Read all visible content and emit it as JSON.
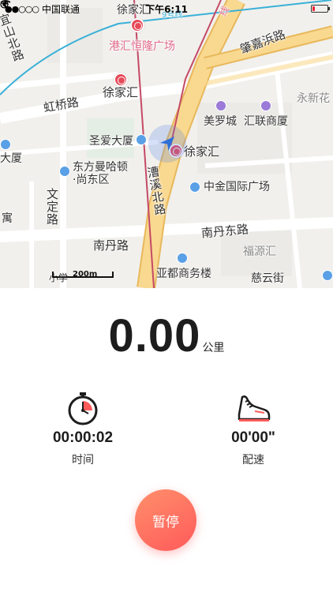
{
  "status_bar": {
    "signal": "●●○○○",
    "carrier": "中国联通",
    "wifi_icon": "wifi-icon",
    "time": "下午6:11",
    "battery_level": 0.15
  },
  "map": {
    "labels": {
      "xujiahui_top": "徐家汇",
      "ganghui": "港汇恒隆广场",
      "zhaojiabang": "肇嘉浜路",
      "yishan": "宜山北路",
      "xujiahui_left": "徐家汇",
      "hongqiao": "虹桥路",
      "yongxinhua": "永新花",
      "meiluocheng": "美罗城",
      "huilian": "汇联商厦",
      "shengai": "圣爱大厦",
      "xujiahui_station": "徐家汇",
      "daxia": "大厦",
      "dongfang": "东方曼哈顿",
      "shangdong": "·尚东区",
      "caoxi": "漕溪北路",
      "zhongjin": "中金国际广场",
      "wending": "文定路",
      "yu": "寓",
      "nandan": "南丹路",
      "nandan_east": "南丹东路",
      "fuyuan": "福源汇",
      "yadu": "亚都商务楼",
      "ciyun": "慈云街",
      "xiaoxue": "小学",
      "line_label": "线",
      "line_label2": "9号线"
    },
    "scale": "200m"
  },
  "distance": {
    "value": "0.00",
    "unit": "公里"
  },
  "stats": {
    "time": {
      "value": "00:00:02",
      "label": "时间",
      "icon": "stopwatch-icon"
    },
    "pace": {
      "value": "00'00\"",
      "label": "配速",
      "icon": "running-shoe-icon"
    }
  },
  "pause_button": {
    "label": "暂停"
  },
  "colors": {
    "accent_start": "#ff8f6b",
    "accent_end": "#ff5a5a",
    "map_road_major": "#f7d486",
    "map_road_minor": "#ffffff",
    "metro": "#e64b5a"
  }
}
